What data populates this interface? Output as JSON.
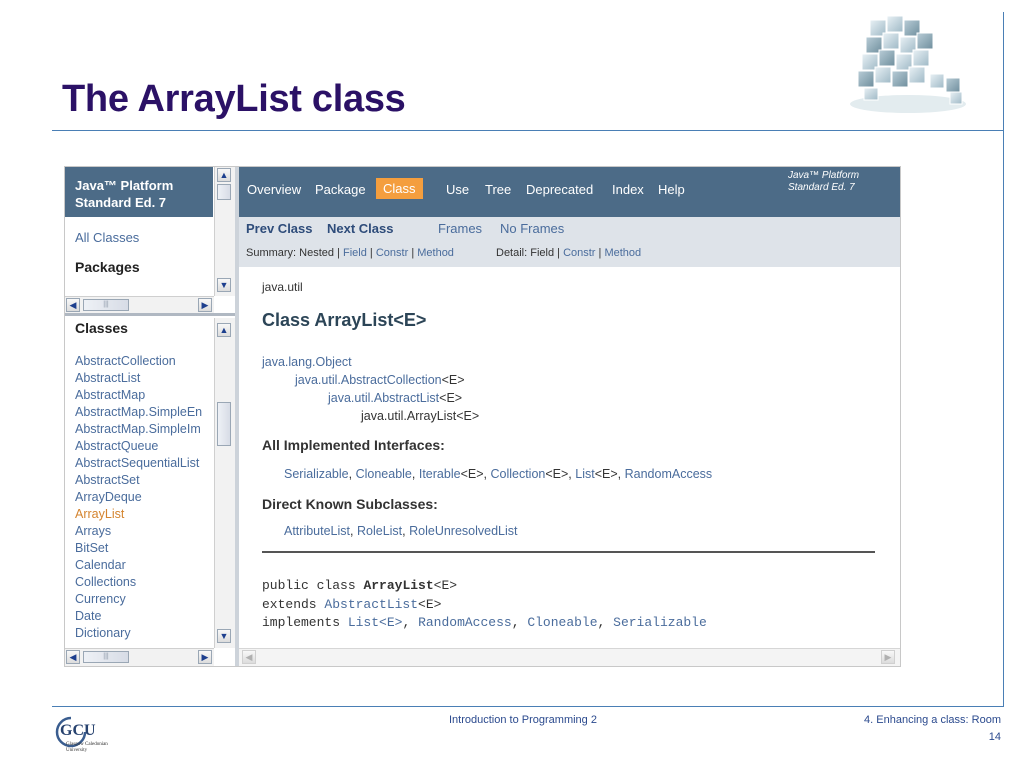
{
  "slide": {
    "title": "The ArrayList class",
    "footer_center": "Introduction to Programming 2",
    "footer_right": "4. Enhancing a class: Room",
    "page_number": "14",
    "logo_text": "GCU",
    "logo_sub1": "Glasgow Caledonian",
    "logo_sub2": "University"
  },
  "left_panel": {
    "header_line1": "Java™ Platform",
    "header_line2": "Standard Ed. 7",
    "all_classes": "All Classes",
    "packages_heading": "Packages",
    "classes_heading": "Classes",
    "classes": [
      "AbstractCollection",
      "AbstractList",
      "AbstractMap",
      "AbstractMap.SimpleEn",
      "AbstractMap.SimpleIm",
      "AbstractQueue",
      "AbstractSequentialList",
      "AbstractSet",
      "ArrayDeque",
      "ArrayList",
      "Arrays",
      "BitSet",
      "Calendar",
      "Collections",
      "Currency",
      "Date",
      "Dictionary"
    ],
    "selected_class": "ArrayList"
  },
  "nav": {
    "items": [
      "Overview",
      "Package",
      "Class",
      "Use",
      "Tree",
      "Deprecated",
      "Index",
      "Help"
    ],
    "active": "Class",
    "brand_line1": "Java™ Platform",
    "brand_line2": "Standard Ed. 7",
    "prev_class": "Prev Class",
    "next_class": "Next Class",
    "frames": "Frames",
    "no_frames": "No Frames",
    "summary_label": "Summary: Nested |",
    "summary_field": "Field",
    "summary_constr": "Constr",
    "summary_method": "Method",
    "detail_label": "Detail: Field |",
    "detail_constr": "Constr",
    "detail_method": "Method",
    "sep": "|"
  },
  "doc": {
    "package": "java.util",
    "class_title": "Class ArrayList<E>",
    "hierarchy": [
      {
        "name": "java.lang.Object",
        "suffix": "",
        "link": true
      },
      {
        "name": "java.util.AbstractCollection",
        "suffix": "<E>",
        "link": true
      },
      {
        "name": "java.util.AbstractList",
        "suffix": "<E>",
        "link": true
      },
      {
        "name": "java.util.ArrayList",
        "suffix": "<E>",
        "link": false
      }
    ],
    "interfaces_heading": "All Implemented Interfaces:",
    "interfaces": {
      "serializable": "Serializable",
      "cloneable": "Cloneable",
      "iterable": "Iterable",
      "collection": "Collection",
      "list": "List",
      "random_access": "RandomAccess",
      "generic": "<E>",
      "comma": ","
    },
    "subclasses_heading": "Direct Known Subclasses:",
    "subclasses": [
      "AttributeList",
      "RoleList",
      "RoleUnresolvedList"
    ],
    "code": {
      "public_class": "public class",
      "class_name": "ArrayList",
      "generic": "<E>",
      "extends": "extends",
      "abstract_list": "AbstractList",
      "implements": "implements",
      "list": "List<E>",
      "random_access": "RandomAccess",
      "cloneable": "Cloneable",
      "serializable": "Serializable",
      "comma": ","
    }
  },
  "scroll_glyphs": {
    "up": "▲",
    "down": "▼",
    "left": "◀",
    "right": "▶",
    "grip": "|||"
  }
}
